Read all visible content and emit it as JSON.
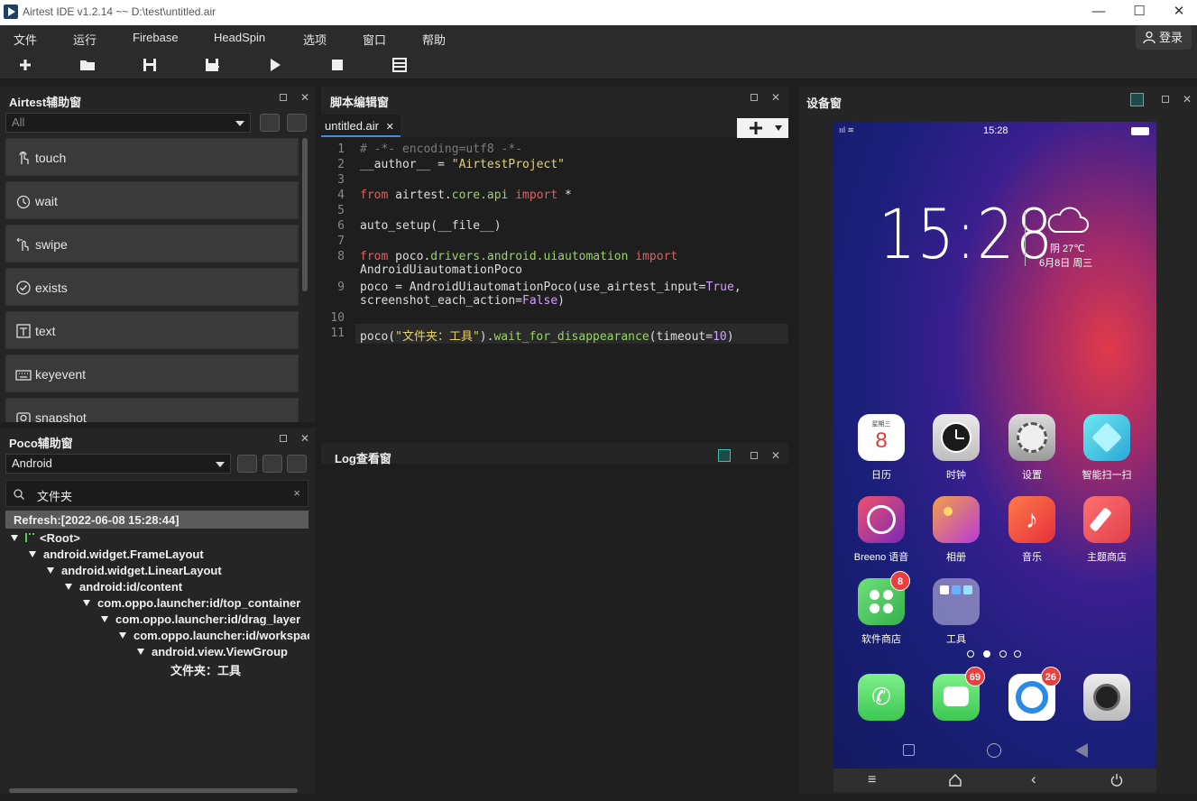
{
  "window": {
    "title": "Airtest IDE v1.2.14 ~~ D:\\test\\untitled.air",
    "controls": {
      "minimize": "—",
      "maximize": "☐",
      "close": "✕"
    }
  },
  "menu": [
    "文件",
    "运行",
    "Firebase",
    "HeadSpin",
    "选项",
    "窗口",
    "帮助"
  ],
  "login_label": "登录",
  "toolbar_icons": [
    "new-icon",
    "open-folder-icon",
    "save-icon",
    "save-as-icon",
    "run-icon",
    "stop-icon",
    "log-icon"
  ],
  "airtest_panel": {
    "title": "Airtest辅助窗",
    "filter_value": "All",
    "apis": [
      {
        "label": "touch",
        "icon": "touch-icon"
      },
      {
        "label": "wait",
        "icon": "clock-icon"
      },
      {
        "label": "swipe",
        "icon": "swipe-icon"
      },
      {
        "label": "exists",
        "icon": "check-circle-icon"
      },
      {
        "label": "text",
        "icon": "text-icon"
      },
      {
        "label": "keyevent",
        "icon": "keyboard-icon"
      },
      {
        "label": "snapshot",
        "icon": "camera-icon"
      }
    ]
  },
  "poco_panel": {
    "title": "Poco辅助窗",
    "mode_value": "Android",
    "search_value": "文件夹",
    "search_clear": "×",
    "refresh_text": "Refresh:[2022-06-08 15:28:44]",
    "tree": [
      {
        "label": "<Root>",
        "depth": 0,
        "expanded": true
      },
      {
        "label": "android.widget.FrameLayout",
        "depth": 1,
        "expanded": true
      },
      {
        "label": "android.widget.LinearLayout",
        "depth": 2,
        "expanded": true
      },
      {
        "label": "android:id/content",
        "depth": 3,
        "expanded": true
      },
      {
        "label": "com.oppo.launcher:id/top_container",
        "depth": 4,
        "expanded": true
      },
      {
        "label": "com.oppo.launcher:id/drag_layer",
        "depth": 5,
        "expanded": true
      },
      {
        "label": "com.oppo.launcher:id/workspac",
        "depth": 6,
        "expanded": true
      },
      {
        "label": "android.view.ViewGroup",
        "depth": 7,
        "expanded": true
      },
      {
        "label": "文件夹：工具",
        "depth": 8,
        "expanded": false
      }
    ]
  },
  "editor_panel": {
    "title": "脚本编辑窗",
    "tab": "untitled.air",
    "tab_close": "✕",
    "add_label": "+",
    "lines": [
      {
        "n": "1",
        "text": "# -*- encoding=utf8 -*-"
      },
      {
        "n": "2",
        "text": "__author__ = \"AirtestProject\""
      },
      {
        "n": "3",
        "text": ""
      },
      {
        "n": "4",
        "text": "from airtest.core.api import *"
      },
      {
        "n": "5",
        "text": ""
      },
      {
        "n": "6",
        "text": "auto_setup(__file__)"
      },
      {
        "n": "7",
        "text": ""
      },
      {
        "n": "8",
        "text": "from poco.drivers.android.uiautomation import AndroidUiautomationPoco"
      },
      {
        "n": "9",
        "text": "poco = AndroidUiautomationPoco(use_airtest_input=True, screenshot_each_action=False)"
      },
      {
        "n": "10",
        "text": ""
      },
      {
        "n": "11",
        "text": "poco(\"文件夹：工具\").wait_for_disappearance(timeout=10)"
      }
    ]
  },
  "log_panel": {
    "title": "Log查看窗"
  },
  "device_panel": {
    "title": "设备窗",
    "status_time": "15:28",
    "clock_time": "15:28",
    "weather": "阴 27℃",
    "date": "6月8日  周三",
    "calendar_icon": {
      "weekday": "星期三",
      "day": "8"
    },
    "apps": [
      {
        "name": "日历",
        "icon": "calendar-icon",
        "color": "#ffffff",
        "badge": ""
      },
      {
        "name": "时钟",
        "icon": "clock-icon",
        "color": "#e0e0e0",
        "badge": ""
      },
      {
        "name": "设置",
        "icon": "settings-icon",
        "color": "#c8c8c8",
        "badge": ""
      },
      {
        "name": "智能扫一扫",
        "icon": "scan-icon",
        "color": "#5ad2e6",
        "badge": ""
      },
      {
        "name": "Breeno 语音",
        "icon": "breeno-icon",
        "color": "#d93a6a",
        "badge": ""
      },
      {
        "name": "相册",
        "icon": "gallery-icon",
        "color": "#c04ad0",
        "badge": ""
      },
      {
        "name": "音乐",
        "icon": "music-icon",
        "color": "#ee5540",
        "badge": ""
      },
      {
        "name": "主题商店",
        "icon": "theme-store-icon",
        "color": "#f05a5a",
        "badge": ""
      },
      {
        "name": "软件商店",
        "icon": "app-store-icon",
        "color": "#5cc86a",
        "badge": "8"
      },
      {
        "name": "工具",
        "icon": "folder-icon",
        "color": "#9a9ab8",
        "badge": ""
      }
    ],
    "dock": [
      {
        "icon": "phone-icon",
        "color": "#4cd964",
        "badge": ""
      },
      {
        "icon": "messages-icon",
        "color": "#4cd964",
        "badge": "69"
      },
      {
        "icon": "browser-icon",
        "color": "#ffffff",
        "badge": "26"
      },
      {
        "icon": "camera-icon",
        "color": "#d8d8d8",
        "badge": ""
      }
    ],
    "page_dots": 4,
    "active_dot": 2
  }
}
